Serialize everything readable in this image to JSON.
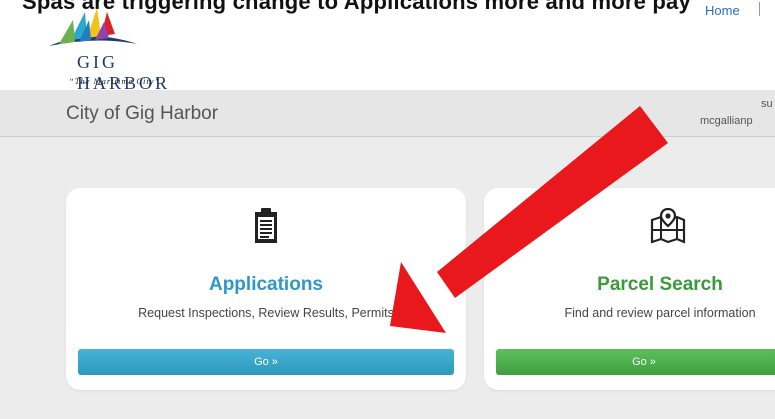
{
  "top": {
    "clipped_text": "Spas are triggering change to Applications more and more pay",
    "home_link": "Home"
  },
  "logo": {
    "name": "GIG HARBOR",
    "tagline": "“The Maritime City”"
  },
  "app": {
    "title": "City of Gig Harbor",
    "user_line1": "su",
    "user_line2": "mcgallianp"
  },
  "cards": [
    {
      "title": "Applications",
      "title_color": "#2f98c4",
      "description": "Request Inspections, Review Results, Permits",
      "button_label": "Go »",
      "icon": "clipboard-icon"
    },
    {
      "title": "Parcel Search",
      "title_color": "#3a9a3a",
      "description": "Find and review parcel information",
      "button_label": "Go »",
      "icon": "map-pin-icon"
    }
  ],
  "annotation": {
    "arrow_color": "#e8181c",
    "icon": "red-arrow-icon"
  }
}
